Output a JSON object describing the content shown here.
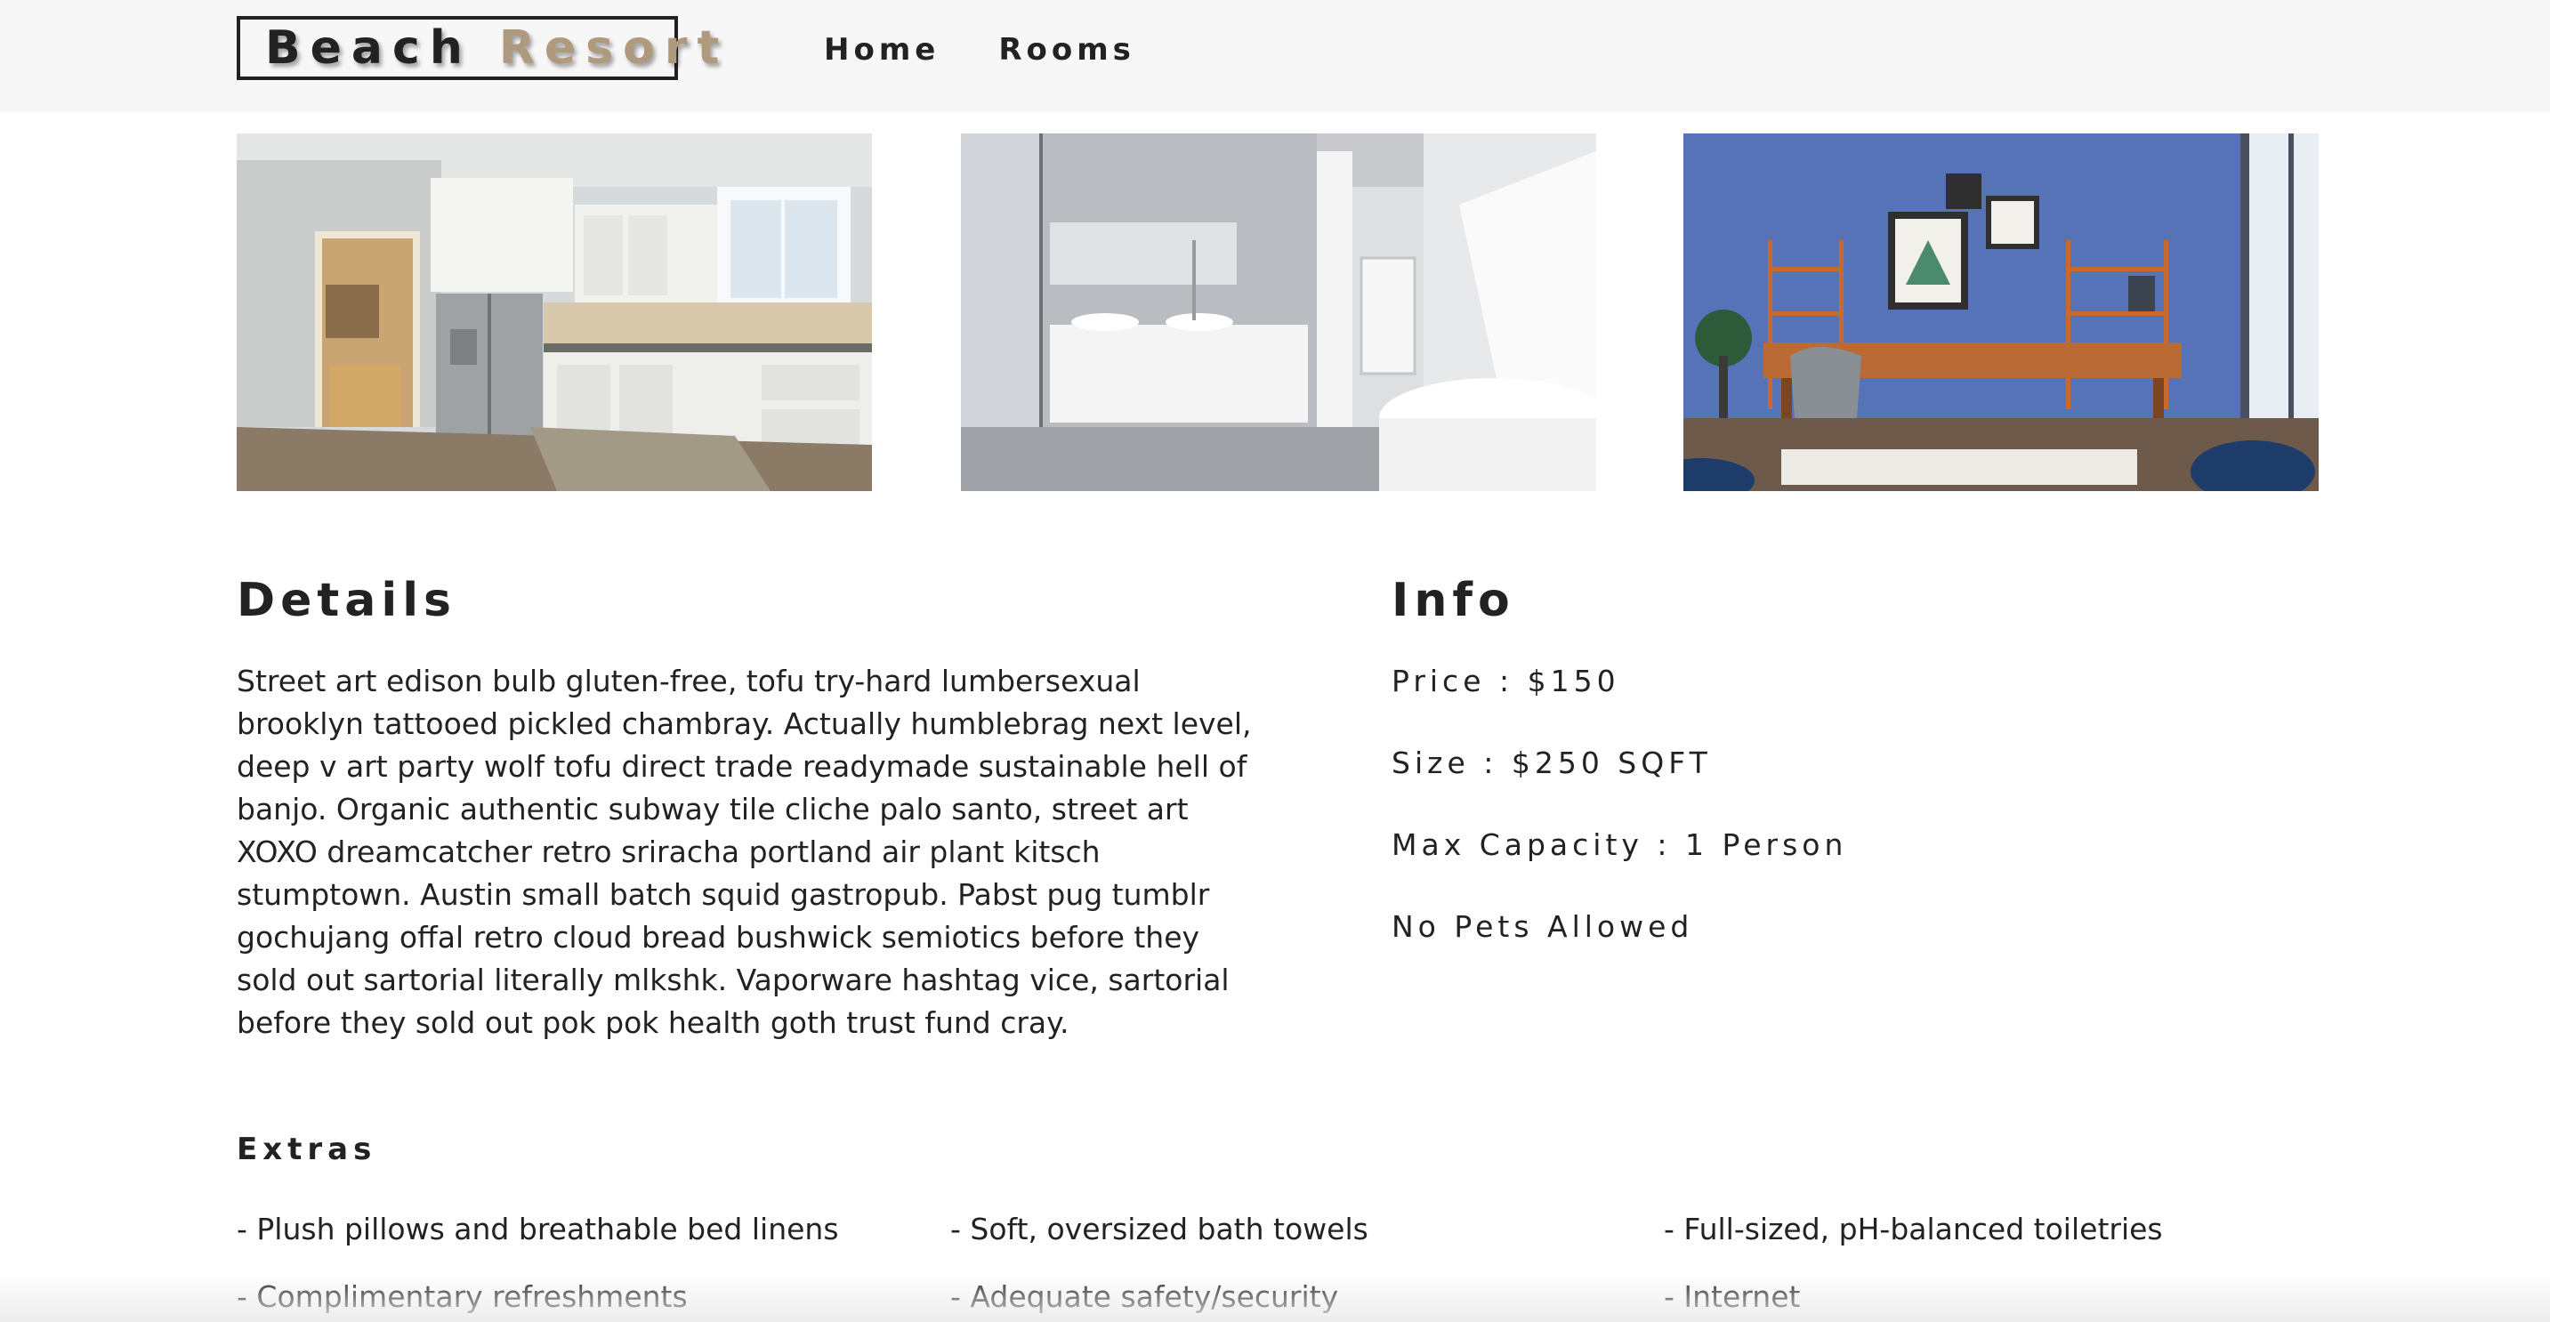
{
  "navbar": {
    "logo": {
      "word1": "Beach",
      "word2": "Resort"
    },
    "links": [
      "Home",
      "Rooms"
    ]
  },
  "photos": [
    {
      "icon": "kitchen-photo"
    },
    {
      "icon": "bathroom-photo"
    },
    {
      "icon": "office-photo"
    }
  ],
  "details": {
    "title": "Details",
    "text": "Street art edison bulb gluten-free, tofu try-hard lumbersexual brooklyn tattooed pickled chambray. Actually humblebrag next level, deep v art party wolf tofu direct trade readymade sustainable hell of banjo. Organic authentic subway tile cliche palo santo, street art XOXO dreamcatcher retro sriracha portland air plant kitsch stumptown. Austin small batch squid gastropub. Pabst pug tumblr gochujang offal retro cloud bread bushwick semiotics before they sold out sartorial literally mlkshk. Vaporware hashtag vice, sartorial before they sold out pok pok health goth trust fund cray."
  },
  "info": {
    "title": "Info",
    "price": "Price : $150",
    "size": "Size : $250 SQFT",
    "capacity": "Max Capacity : 1 Person",
    "pets": "No Pets Allowed"
  },
  "extras": {
    "title": "Extras",
    "items": [
      "- Plush pillows and breathable bed linens",
      "- Soft, oversized bath towels",
      "- Full-sized, pH-balanced toiletries",
      "- Complimentary refreshments",
      "- Adequate safety/security",
      "- Internet"
    ]
  },
  "colors": {
    "navbar_bg": "#f7f7f7",
    "logo_accent": "#af9a7d",
    "text": "#222222"
  }
}
